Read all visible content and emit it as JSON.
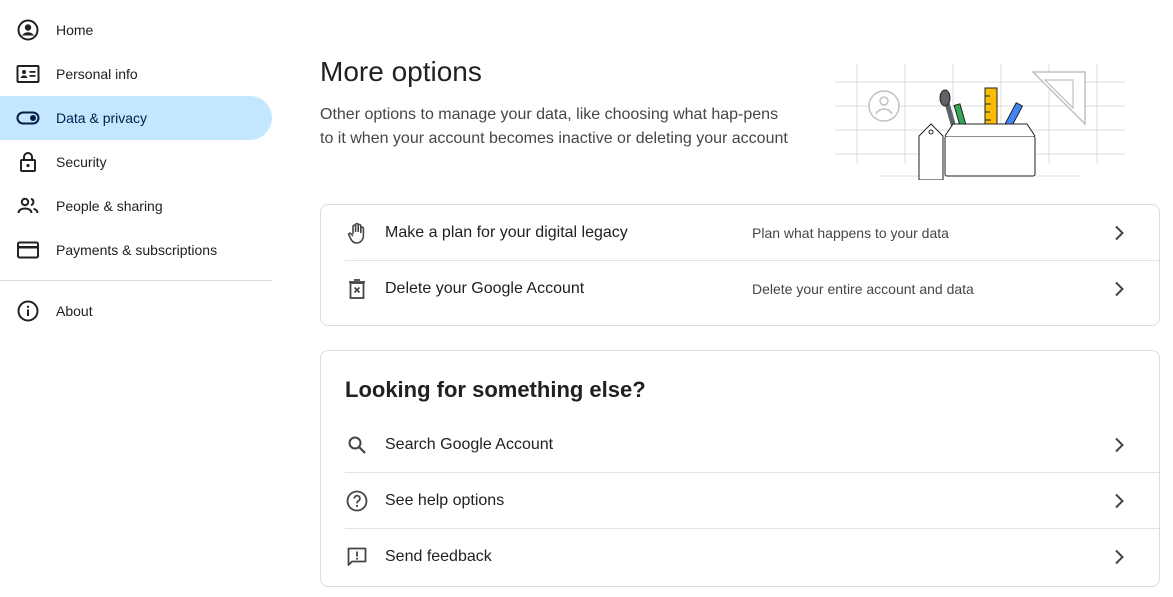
{
  "sidebar": {
    "items": [
      {
        "label": "Home",
        "icon": "account-circle-icon"
      },
      {
        "label": "Personal info",
        "icon": "id-card-icon"
      },
      {
        "label": "Data & privacy",
        "icon": "toggle-icon",
        "active": true
      },
      {
        "label": "Security",
        "icon": "lock-icon"
      },
      {
        "label": "People & sharing",
        "icon": "people-icon"
      },
      {
        "label": "Payments & subscriptions",
        "icon": "credit-card-icon"
      }
    ],
    "about": {
      "label": "About",
      "icon": "info-icon"
    }
  },
  "main": {
    "title": "More options",
    "description": "Other options to manage your data, like choosing what hap-pens to it when your account becomes inactive or deleting your account",
    "options": [
      {
        "label": "Make a plan for your digital legacy",
        "sub": "Plan what happens to your data",
        "icon": "hand-icon"
      },
      {
        "label": "Delete your Google Account",
        "sub": "Delete your entire account and data",
        "icon": "trash-icon"
      }
    ],
    "help": {
      "title": "Looking for something else?",
      "items": [
        {
          "label": "Search Google Account",
          "icon": "search-icon"
        },
        {
          "label": "See help options",
          "icon": "help-icon"
        },
        {
          "label": "Send feedback",
          "icon": "feedback-icon"
        }
      ]
    }
  },
  "colors": {
    "active_bg": "#c2e7ff",
    "border": "#dadce0",
    "text": "#202124",
    "secondary": "#444746"
  }
}
